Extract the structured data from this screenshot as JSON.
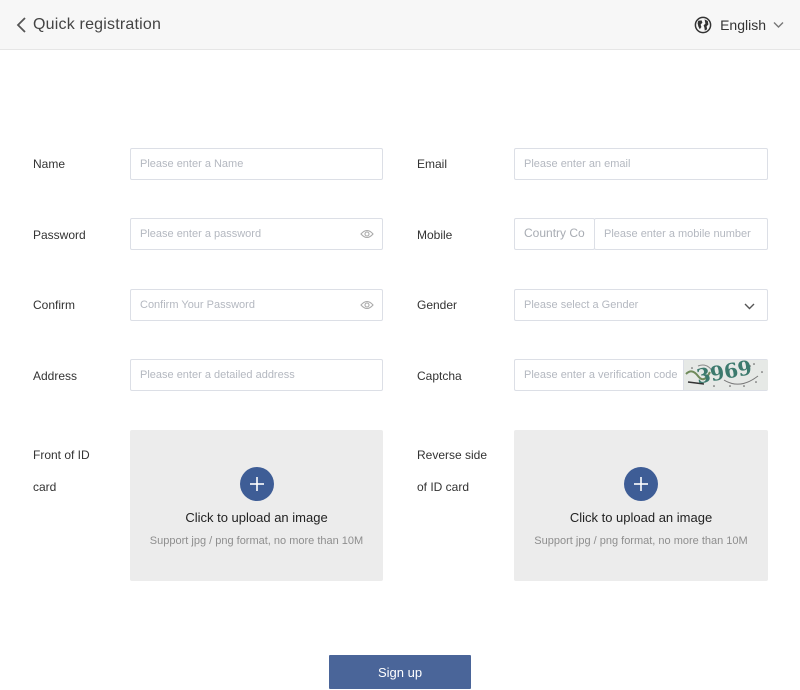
{
  "header": {
    "back_icon": "chevron-left-icon",
    "title": "Quick registration",
    "language": {
      "icon": "globe-icon",
      "label": "English",
      "dropdown_icon": "chevron-down-icon"
    }
  },
  "form": {
    "name": {
      "label": "Name",
      "placeholder": "Please enter a Name"
    },
    "email": {
      "label": "Email",
      "placeholder": "Please enter an email"
    },
    "password": {
      "label": "Password",
      "placeholder": "Please enter a password",
      "icon": "eye-icon"
    },
    "mobile": {
      "label": "Mobile",
      "country_code_placeholder": "Country Code",
      "placeholder": "Please enter a mobile number"
    },
    "confirm": {
      "label": "Confirm",
      "placeholder": "Confirm Your Password",
      "icon": "eye-icon"
    },
    "gender": {
      "label": "Gender",
      "placeholder": "Please select a Gender",
      "icon": "chevron-down-icon"
    },
    "address": {
      "label": "Address",
      "placeholder": "Please enter a detailed address"
    },
    "captcha": {
      "label": "Captcha",
      "placeholder": "Please enter a verification code",
      "image_text": "3969"
    },
    "id_front": {
      "label_line1": "Front of ID",
      "label_line2": "card",
      "icon": "plus-icon",
      "upload_text": "Click to upload an image",
      "hint": "Support jpg / png format, no more than 10M"
    },
    "id_back": {
      "label_line1": "Reverse side",
      "label_line2": "of ID card",
      "icon": "plus-icon",
      "upload_text": "Click to upload an image",
      "hint": "Support jpg / png format, no more than 10M"
    }
  },
  "actions": {
    "signup_label": "Sign up"
  },
  "colors": {
    "primary": "#4a6599",
    "upload_plus": "#3e5d96",
    "header_bg": "#f7f7f7",
    "border": "#dcdfe6",
    "upload_bg": "#ececec"
  }
}
